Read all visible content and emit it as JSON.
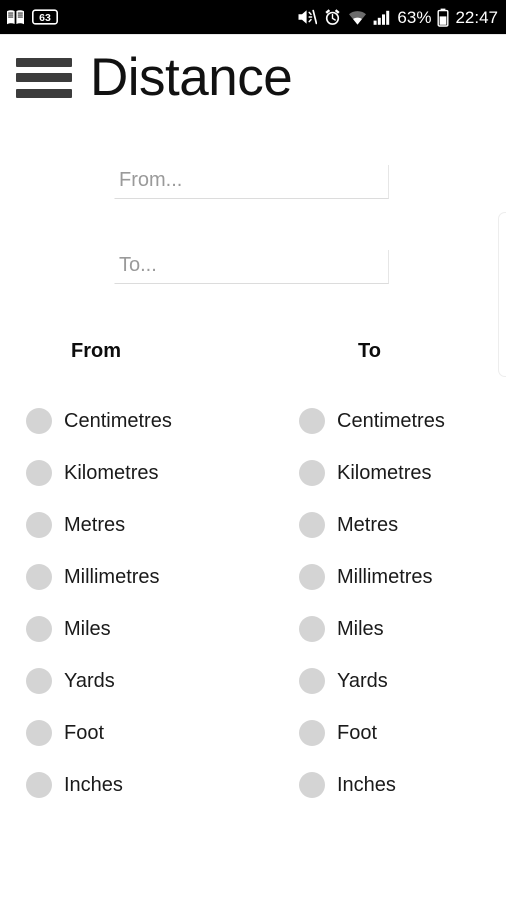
{
  "status_bar": {
    "background_color": "#000000",
    "left_icons": [
      {
        "name": "book-notification-icon",
        "glyph": "book"
      },
      {
        "name": "sixty-three-badge-icon",
        "label": "63"
      }
    ],
    "right_icons": [
      {
        "name": "volume-mute-icon"
      },
      {
        "name": "alarm-clock-icon"
      },
      {
        "name": "wifi-icon"
      },
      {
        "name": "cellular-signal-icon"
      }
    ],
    "battery_percent": "63%",
    "clock": "22:47"
  },
  "header": {
    "title": "Distance",
    "menu_icon": "hamburger-menu-icon"
  },
  "inputs": {
    "from": {
      "value": "",
      "placeholder": "From..."
    },
    "to": {
      "value": "",
      "placeholder": "To..."
    }
  },
  "columns": {
    "from": {
      "header": "From",
      "units": [
        "Centimetres",
        "Kilometres",
        "Metres",
        "Millimetres",
        "Miles",
        "Yards",
        "Foot",
        "Inches"
      ]
    },
    "to": {
      "header": "To",
      "units": [
        "Centimetres",
        "Kilometres",
        "Metres",
        "Millimetres",
        "Miles",
        "Yards",
        "Foot",
        "Inches"
      ]
    }
  },
  "colors": {
    "background": "#ffffff",
    "status_bar": "#000000",
    "title_text": "#111111",
    "radio_unselected": "#d4d4d4",
    "placeholder_text": "#9a9a9a",
    "underline": "#dcdcdc"
  }
}
